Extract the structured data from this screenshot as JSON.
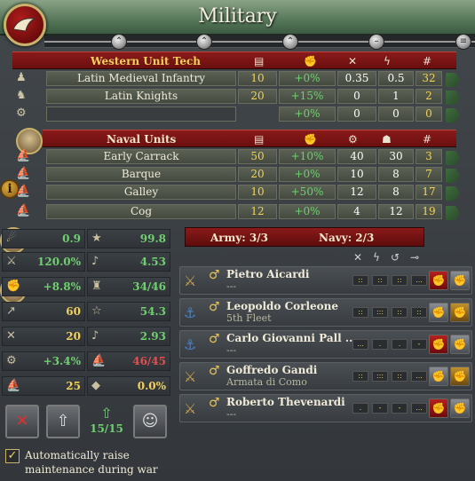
{
  "window": {
    "title": "Military"
  },
  "land": {
    "header": "Western Unit Tech",
    "rows": [
      {
        "name": "Latin Medieval Infantry",
        "cost": "10",
        "morale": "+0%",
        "a": "0.35",
        "b": "0.5",
        "count": "32"
      },
      {
        "name": "Latin Knights",
        "cost": "20",
        "morale": "+15%",
        "a": "0",
        "b": "1",
        "count": "2"
      },
      {
        "name": "",
        "cost": "",
        "morale": "+0%",
        "a": "0",
        "b": "0",
        "count": "0"
      }
    ]
  },
  "naval": {
    "header": "Naval Units",
    "rows": [
      {
        "name": "Early Carrack",
        "cost": "50",
        "morale": "+10%",
        "a": "40",
        "b": "30",
        "count": "3"
      },
      {
        "name": "Barque",
        "cost": "20",
        "morale": "+0%",
        "a": "10",
        "b": "8",
        "count": "7"
      },
      {
        "name": "Galley",
        "cost": "10",
        "morale": "+50%",
        "a": "12",
        "b": "8",
        "count": "17"
      },
      {
        "name": "Cog",
        "cost": "12",
        "morale": "+0%",
        "a": "4",
        "b": "12",
        "count": "19"
      }
    ]
  },
  "stats": {
    "left": [
      "0.9",
      "120.0%",
      "+8.8%",
      "60",
      "20",
      "+3.4%",
      "25"
    ],
    "right": [
      "99.8",
      "4.53",
      "34/46",
      "54.3",
      "2.93",
      "46/45",
      "0.0%"
    ]
  },
  "recruit_count": "15/15",
  "maintenance_checkbox": {
    "checked": true,
    "label": "Automatically raise maintenance during war"
  },
  "army_bar": {
    "army": "Army: 3/3",
    "navy": "Navy: 2/3"
  },
  "leaders": [
    {
      "name": "Pietro Aicardi",
      "sub": "---",
      "pips": [
        "::",
        "::",
        "::",
        "..."
      ]
    },
    {
      "name": "Leopoldo Corleone",
      "sub": "5th Fleet",
      "pips": [
        "::",
        ":::",
        "::",
        "::"
      ]
    },
    {
      "name": "Carlo Giovanni Pall ...",
      "sub": "---",
      "pips": [
        "...",
        ".",
        ".",
        "-"
      ]
    },
    {
      "name": "Goffredo Gandi",
      "sub": "Armata di Como",
      "pips": [
        "::",
        ":::",
        "::",
        "..."
      ]
    },
    {
      "name": "Roberto Thevenardi",
      "sub": "---",
      "pips": [
        ".",
        "-",
        "-",
        "..."
      ]
    }
  ],
  "colors": {
    "accent": "#f2d25a",
    "positive": "#6fd06f",
    "negative": "#e05050",
    "ribbon": "#8a1a1a"
  }
}
